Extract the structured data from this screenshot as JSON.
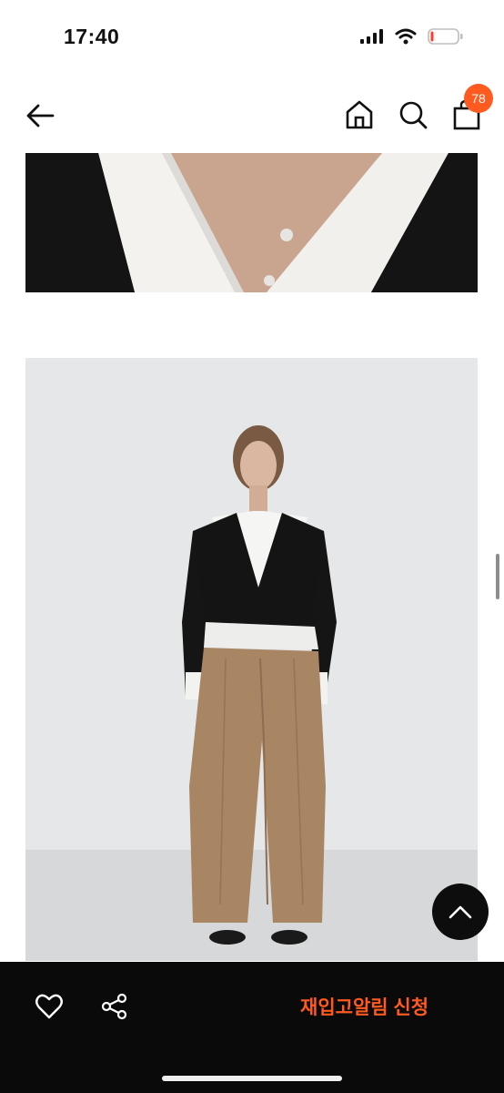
{
  "status_bar": {
    "time": "17:40"
  },
  "nav": {
    "back_icon": "arrow-left-icon",
    "home_icon": "home-icon",
    "search_icon": "search-icon",
    "bag_icon": "shopping-bag-icon",
    "cart_count": "78"
  },
  "images": {
    "top": "product-detail-image-neckline",
    "main": "product-full-body-image"
  },
  "bottom_bar": {
    "like_icon": "heart-icon",
    "share_icon": "share-icon",
    "restock_label": "재입고알림 신청"
  },
  "colors": {
    "accent": "#ff5a1f",
    "bar_bg": "#0a0a0a"
  }
}
